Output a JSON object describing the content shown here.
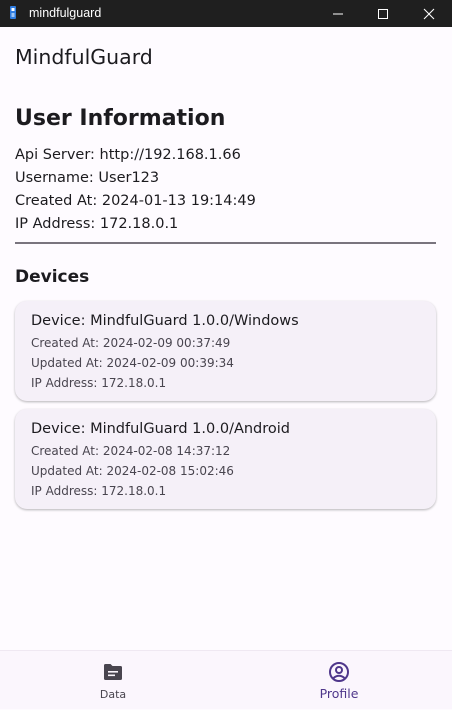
{
  "window": {
    "title": "mindfulguard"
  },
  "appbar": {
    "title": "MindfulGuard"
  },
  "user_info": {
    "heading": "User Information",
    "api_server": "Api Server: http://192.168.1.66",
    "username": "Username: User123",
    "created_at": "Created At: 2024-01-13 19:14:49",
    "ip_address": "IP Address: 172.18.0.1"
  },
  "devices": {
    "heading": "Devices",
    "items": [
      {
        "title": "Device: MindfulGuard 1.0.0/Windows",
        "created_at": "Created At: 2024-02-09 00:37:49",
        "updated_at": "Updated At: 2024-02-09 00:39:34",
        "ip_address": "IP Address: 172.18.0.1"
      },
      {
        "title": "Device: MindfulGuard 1.0.0/Android",
        "created_at": "Created At: 2024-02-08 14:37:12",
        "updated_at": "Updated At: 2024-02-08 15:02:46",
        "ip_address": "IP Address: 172.18.0.1"
      }
    ]
  },
  "bottom_nav": {
    "items": [
      {
        "label": "Data",
        "icon": "folder-icon",
        "selected": false
      },
      {
        "label": "Profile",
        "icon": "account-circle-icon",
        "selected": true
      }
    ]
  },
  "colors": {
    "background": "#fefbff",
    "titlebar": "#1f1f1f",
    "card": "#f5f0f8",
    "selected_nav": "#4f378b",
    "unselected_nav": "#49454f"
  }
}
